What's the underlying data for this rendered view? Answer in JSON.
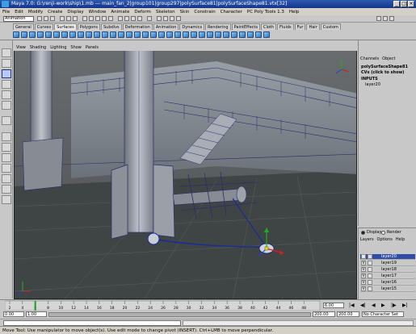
{
  "window": {
    "title": "Maya 7.0: G:\\renji-work\\ship\\1.mb  ---  main_fan_2|group101|group297|polySurface81|polySurfaceShape81.vtx[32]"
  },
  "menubar": {
    "items": [
      "File",
      "Edit",
      "Modify",
      "Create",
      "Display",
      "Window",
      "Animate",
      "Deform",
      "Skeleton",
      "Skin",
      "Constrain",
      "Character",
      "PC Poly Tools 1.3",
      "Help"
    ]
  },
  "statusline": {
    "mode": "Animation"
  },
  "shelf": {
    "tabs": [
      "General",
      "Curves",
      "Surfaces",
      "Polygons",
      "Subdivs",
      "Deformation",
      "Animation",
      "Dynamics",
      "Rendering",
      "PaintEffects",
      "Cloth",
      "Fluids",
      "Fur",
      "Hair",
      "Custom"
    ],
    "active_tab": "Surfaces"
  },
  "viewport": {
    "menu": [
      "View",
      "Shading",
      "Lighting",
      "Show",
      "Panels"
    ]
  },
  "channelbox": {
    "tabs": [
      "Channels",
      "Object"
    ],
    "object_name": "polySurfaceShape81",
    "cvs_label": "CVs (click to show)",
    "inputs_label": "INPUTS",
    "input_item": "layer20"
  },
  "layereditor": {
    "display_label": "Display",
    "render_label": "Render",
    "menu": [
      "Layers",
      "Options",
      "Help"
    ],
    "layers": [
      {
        "v": "V",
        "name": "layer20",
        "selected": true
      },
      {
        "v": "V",
        "name": "layer19",
        "selected": false
      },
      {
        "v": "V",
        "name": "layer18",
        "selected": false
      },
      {
        "v": "V",
        "name": "layer17",
        "selected": false
      },
      {
        "v": "V",
        "name": "layer16",
        "selected": false
      },
      {
        "v": "V",
        "name": "layer15",
        "selected": false
      }
    ]
  },
  "timeslider": {
    "ticks": [
      "2",
      "4",
      "6",
      "8",
      "10",
      "12",
      "14",
      "16",
      "18",
      "20",
      "22",
      "24",
      "26",
      "28",
      "30",
      "32",
      "34",
      "36",
      "38",
      "40",
      "42",
      "44",
      "46",
      "48"
    ],
    "current_frame": "6.00"
  },
  "rangeslider": {
    "start": "0.00",
    "inner_start": "1.00",
    "inner_end": "200.00",
    "end": "200.00",
    "character": "No Character Set"
  },
  "helpline": {
    "text": "Move Tool: Use manipulator to move object(s). Use edit mode to change pivot (INSERT). Ctrl+LMB to move perpendicular."
  },
  "colors": {
    "titlebar": "#14348a",
    "selection": "#2f4ca8",
    "viewport_bg": "#4a4a4a",
    "grid_floor": "#3f4445"
  }
}
